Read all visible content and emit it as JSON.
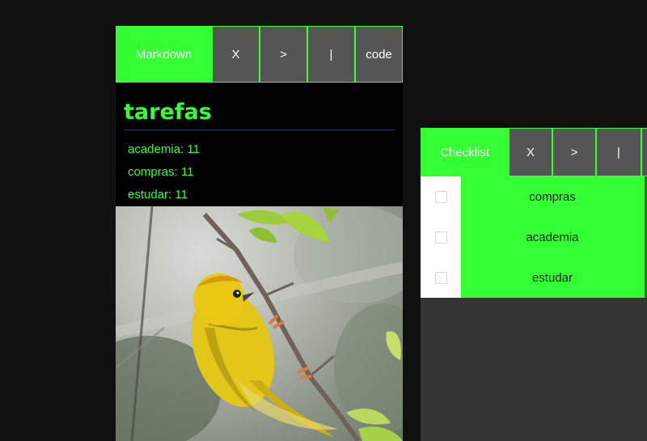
{
  "markdown_panel": {
    "toolbar": {
      "title": "Markdown",
      "close_label": "X",
      "next_label": ">",
      "divider_label": "|",
      "code_label": "code"
    },
    "heading": "tarefas",
    "items": [
      {
        "text": "academia: 11"
      },
      {
        "text": "compras: 11"
      },
      {
        "text": "estudar: 11"
      }
    ]
  },
  "checklist_panel": {
    "toolbar": {
      "title": "Checklist",
      "close_label": "X",
      "next_label": ">",
      "divider_label": "|"
    },
    "items": [
      {
        "label": "compras",
        "checked": false
      },
      {
        "label": "academia",
        "checked": false
      },
      {
        "label": "estudar",
        "checked": false
      }
    ]
  },
  "colors": {
    "accent": "#33ff33",
    "button_bg": "#555555",
    "page_bg": "#101010",
    "panel_bg": "#333333"
  },
  "image": {
    "icon": "bird-photo"
  }
}
